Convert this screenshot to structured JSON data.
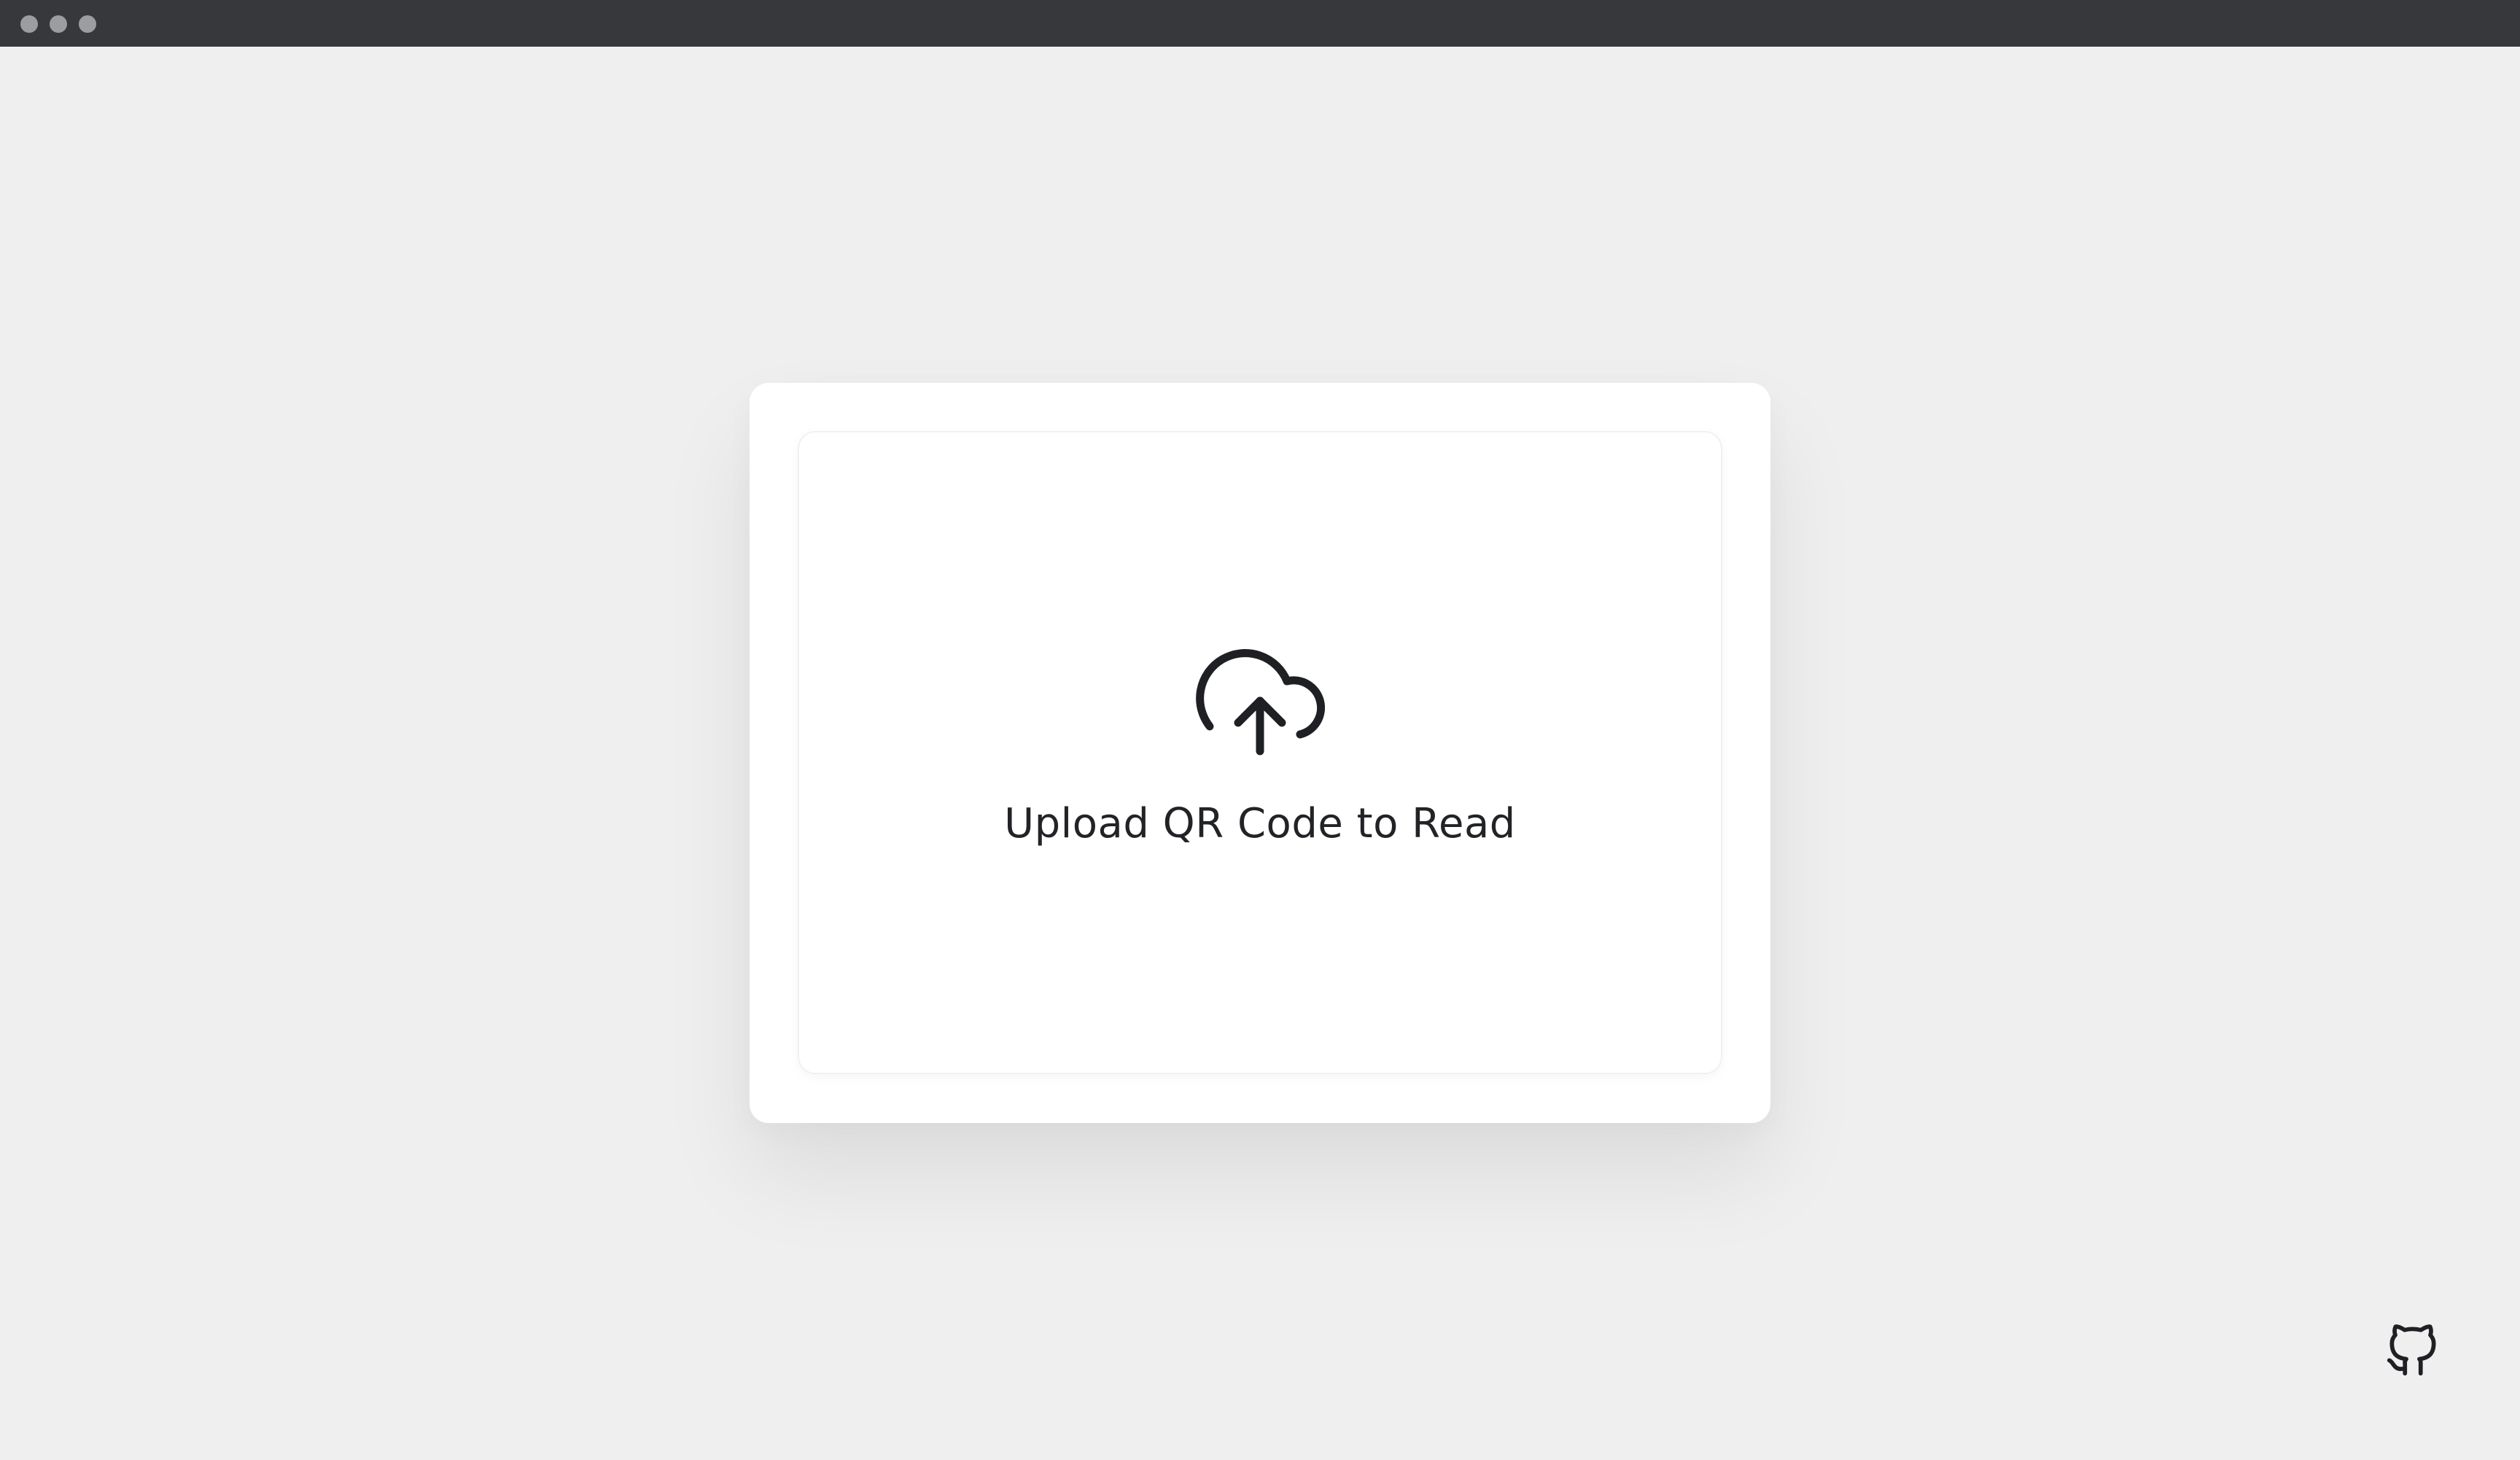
{
  "window": {
    "controls": [
      "close",
      "minimize",
      "maximize"
    ]
  },
  "upload": {
    "label": "Upload QR Code to Read",
    "icon": "cloud-upload-icon"
  },
  "footer": {
    "link_icon": "github-icon"
  },
  "colors": {
    "page_background": "#efefef",
    "window_bar": "#37383b",
    "card": "#ffffff",
    "text": "#222326",
    "icon": "#1f2023"
  }
}
